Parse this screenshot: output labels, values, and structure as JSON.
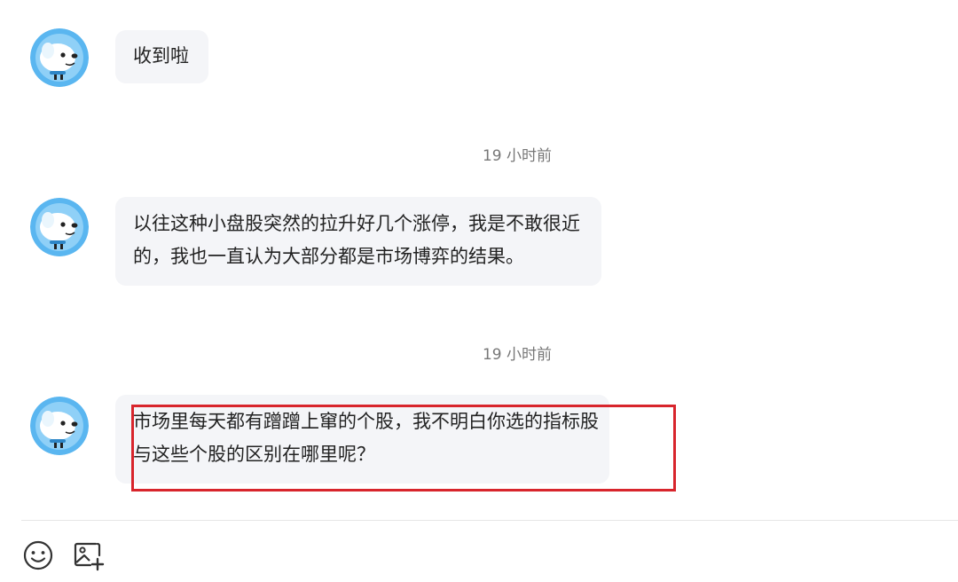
{
  "messages": [
    {
      "sender": "avatar",
      "lines": [
        "收到啦"
      ]
    },
    {
      "timestamp": "19 小时前",
      "lines": [
        "以往这种小盘股突然的拉升好几个涨停，我是不敢很近",
        "的，我也一直认为大部分都是市场博弈的结果。"
      ]
    },
    {
      "timestamp": "19 小时前",
      "lines": [
        "市场里每天都有蹭蹭上窜的个股，我不明白你选的指标股",
        "与这些个股的区别在哪里呢？"
      ]
    }
  ],
  "colors": {
    "bubble_bg": "#f4f5f8",
    "highlight_border": "#d8252c",
    "avatar_blue": "#5ab6f0"
  },
  "toolbar": {
    "emoji_icon": "smiley-icon",
    "image_icon": "add-image-icon"
  }
}
